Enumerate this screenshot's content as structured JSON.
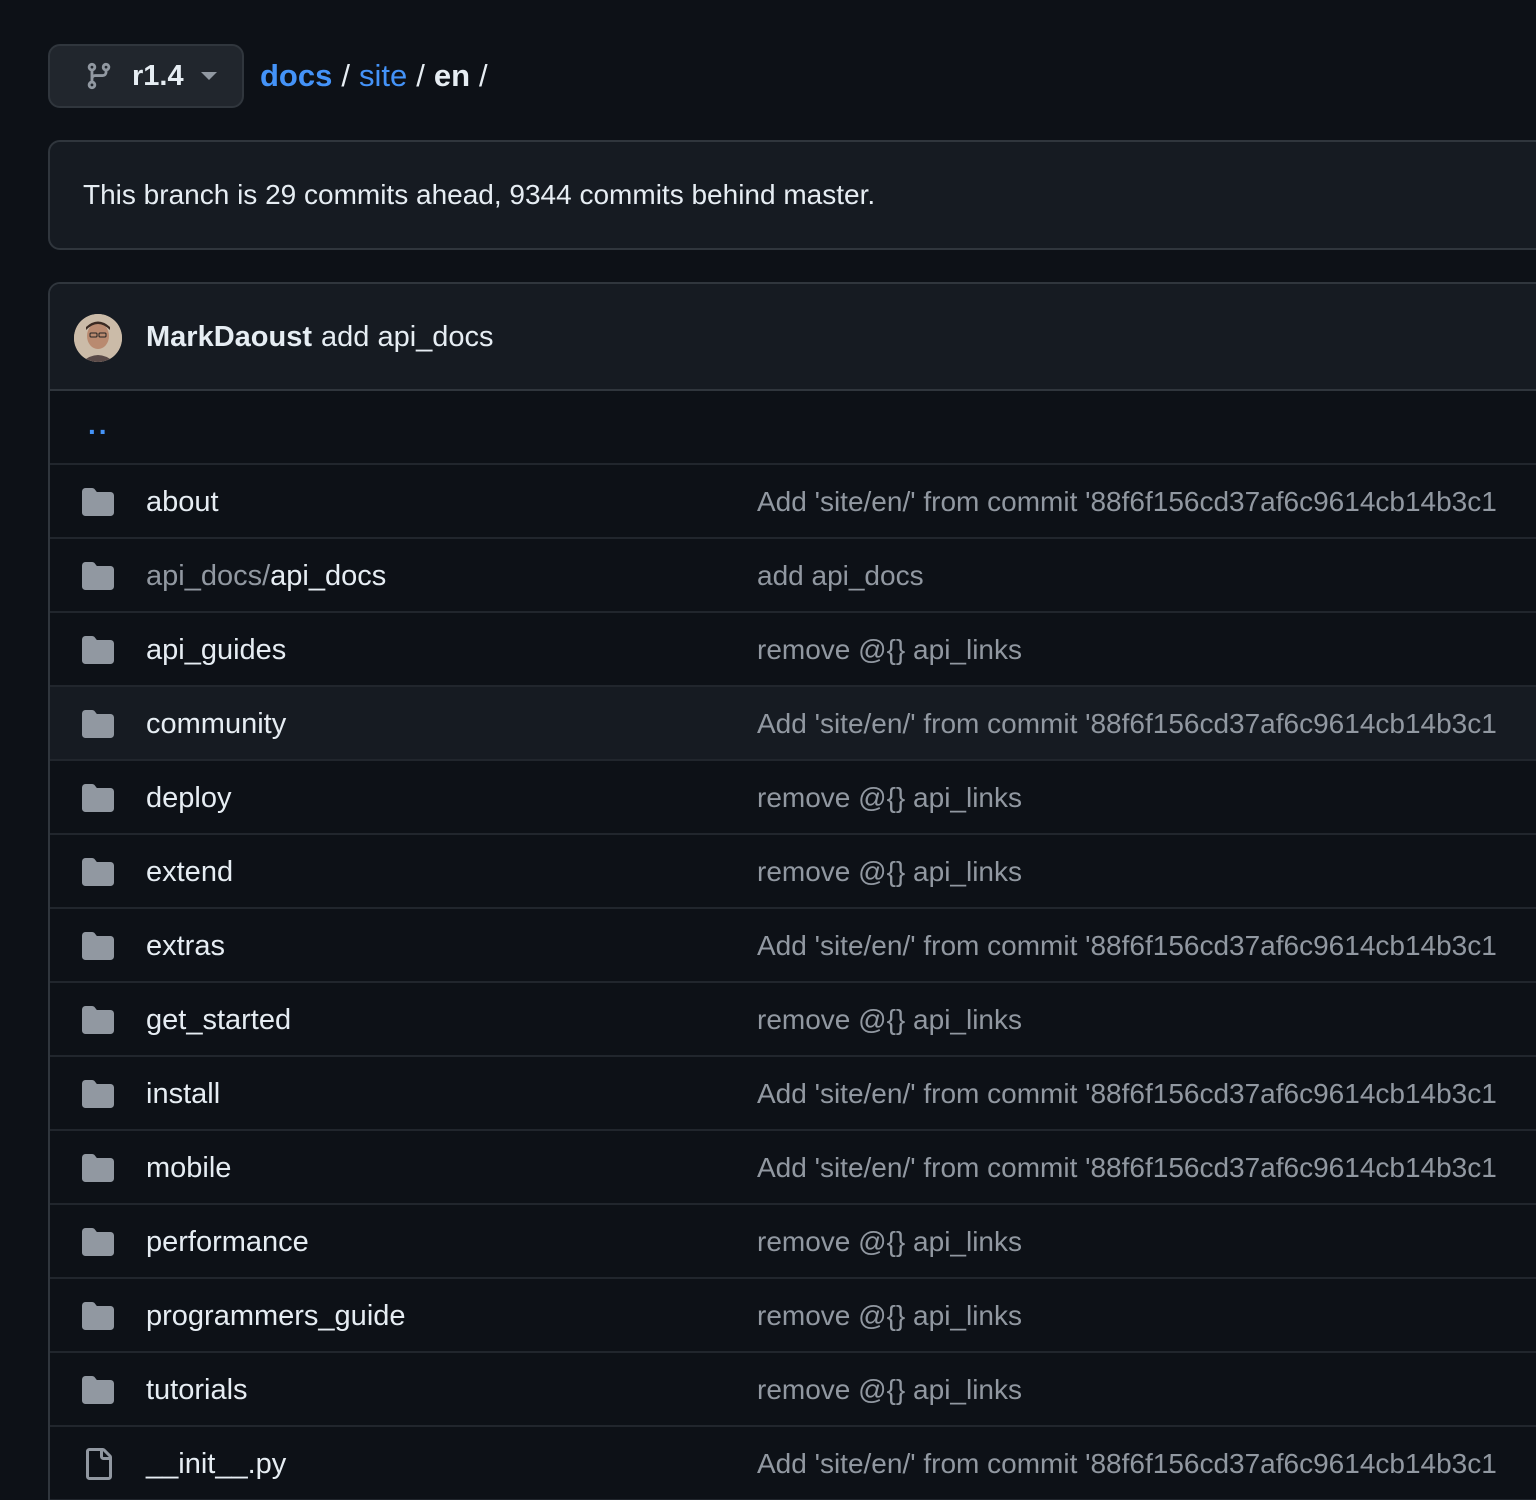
{
  "branch": {
    "name": "r1.4"
  },
  "breadcrumb": {
    "crumbs": [
      "docs",
      "site"
    ],
    "current": "en",
    "separator": "/"
  },
  "banner": {
    "text": "This branch is 29 commits ahead, 9344 commits behind master."
  },
  "latest_commit": {
    "author": "MarkDaoust",
    "message": "add api_docs"
  },
  "parent_dir": {
    "label": ".."
  },
  "files": [
    {
      "type": "folder",
      "name": "about",
      "commit": "Add 'site/en/' from commit '88f6f156cd37af6c9614cb14b3c1"
    },
    {
      "type": "folder",
      "name_prefix": "api_docs/",
      "name": "api_docs",
      "commit": "add api_docs"
    },
    {
      "type": "folder",
      "name": "api_guides",
      "commit": "remove @{} api_links"
    },
    {
      "type": "folder",
      "name": "community",
      "commit": "Add 'site/en/' from commit '88f6f156cd37af6c9614cb14b3c1"
    },
    {
      "type": "folder",
      "name": "deploy",
      "commit": "remove @{} api_links"
    },
    {
      "type": "folder",
      "name": "extend",
      "commit": "remove @{} api_links"
    },
    {
      "type": "folder",
      "name": "extras",
      "commit": "Add 'site/en/' from commit '88f6f156cd37af6c9614cb14b3c1"
    },
    {
      "type": "folder",
      "name": "get_started",
      "commit": "remove @{} api_links"
    },
    {
      "type": "folder",
      "name": "install",
      "commit": "Add 'site/en/' from commit '88f6f156cd37af6c9614cb14b3c1"
    },
    {
      "type": "folder",
      "name": "mobile",
      "commit": "Add 'site/en/' from commit '88f6f156cd37af6c9614cb14b3c1"
    },
    {
      "type": "folder",
      "name": "performance",
      "commit": "remove @{} api_links"
    },
    {
      "type": "folder",
      "name": "programmers_guide",
      "commit": "remove @{} api_links"
    },
    {
      "type": "folder",
      "name": "tutorials",
      "commit": "remove @{} api_links"
    },
    {
      "type": "file",
      "name": "__init__.py",
      "commit": "Add 'site/en/' from commit '88f6f156cd37af6c9614cb14b3c1"
    }
  ],
  "theme": {
    "background": "#0d1117",
    "link": "#4493f8",
    "muted_text": "#9198a1",
    "icon_gray": "#9198a1",
    "success": "#3fb950"
  }
}
